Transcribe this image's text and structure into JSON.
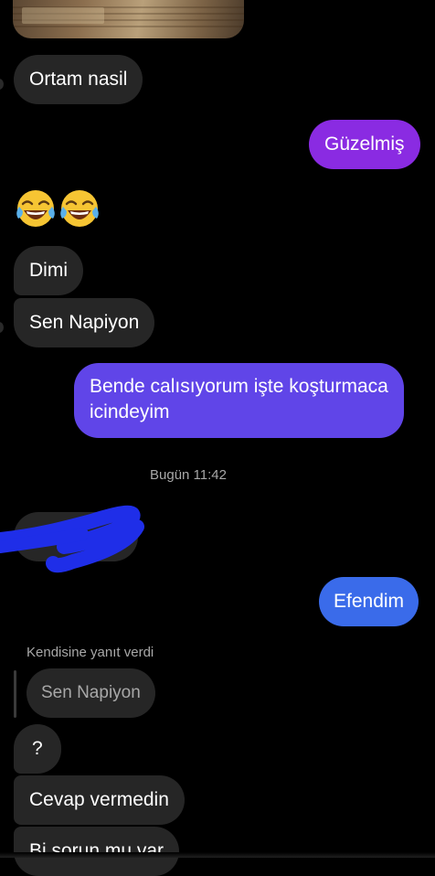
{
  "colors": {
    "background": "#000000",
    "incoming_bubble": "#262626",
    "outgoing_purple": "#8a2be2",
    "outgoing_indigo": "#6045e8",
    "outgoing_blue": "#3a6bea",
    "muted_text": "#a8a8a8"
  },
  "messages": [
    {
      "id": "m1",
      "text": "Ortam nasil"
    },
    {
      "id": "m2",
      "text": "Güzelmiş"
    },
    {
      "id": "m3",
      "emoji": [
        "face-with-tears-of-joy",
        "face-with-tears-of-joy"
      ]
    },
    {
      "id": "m4",
      "text": "Dimi"
    },
    {
      "id": "m5",
      "text": "Sen Napiyon"
    },
    {
      "id": "m6",
      "lines": [
        "Bende calısıyorum işte koşturmaca",
        "icindeyim"
      ]
    },
    {
      "id": "m7",
      "text": "Bugün 11:42"
    },
    {
      "id": "m8",
      "note": "message obscured by blue scribble"
    },
    {
      "id": "m9",
      "text": "Efendim"
    },
    {
      "id": "m10",
      "reply_label": "Kendisine yanıt verdi",
      "quoted": "Sen Napiyon"
    },
    {
      "id": "m11",
      "text": "?"
    },
    {
      "id": "m12",
      "text": "Cevap vermedin"
    },
    {
      "id": "m13",
      "text": "Bi sorun mu var"
    }
  ]
}
